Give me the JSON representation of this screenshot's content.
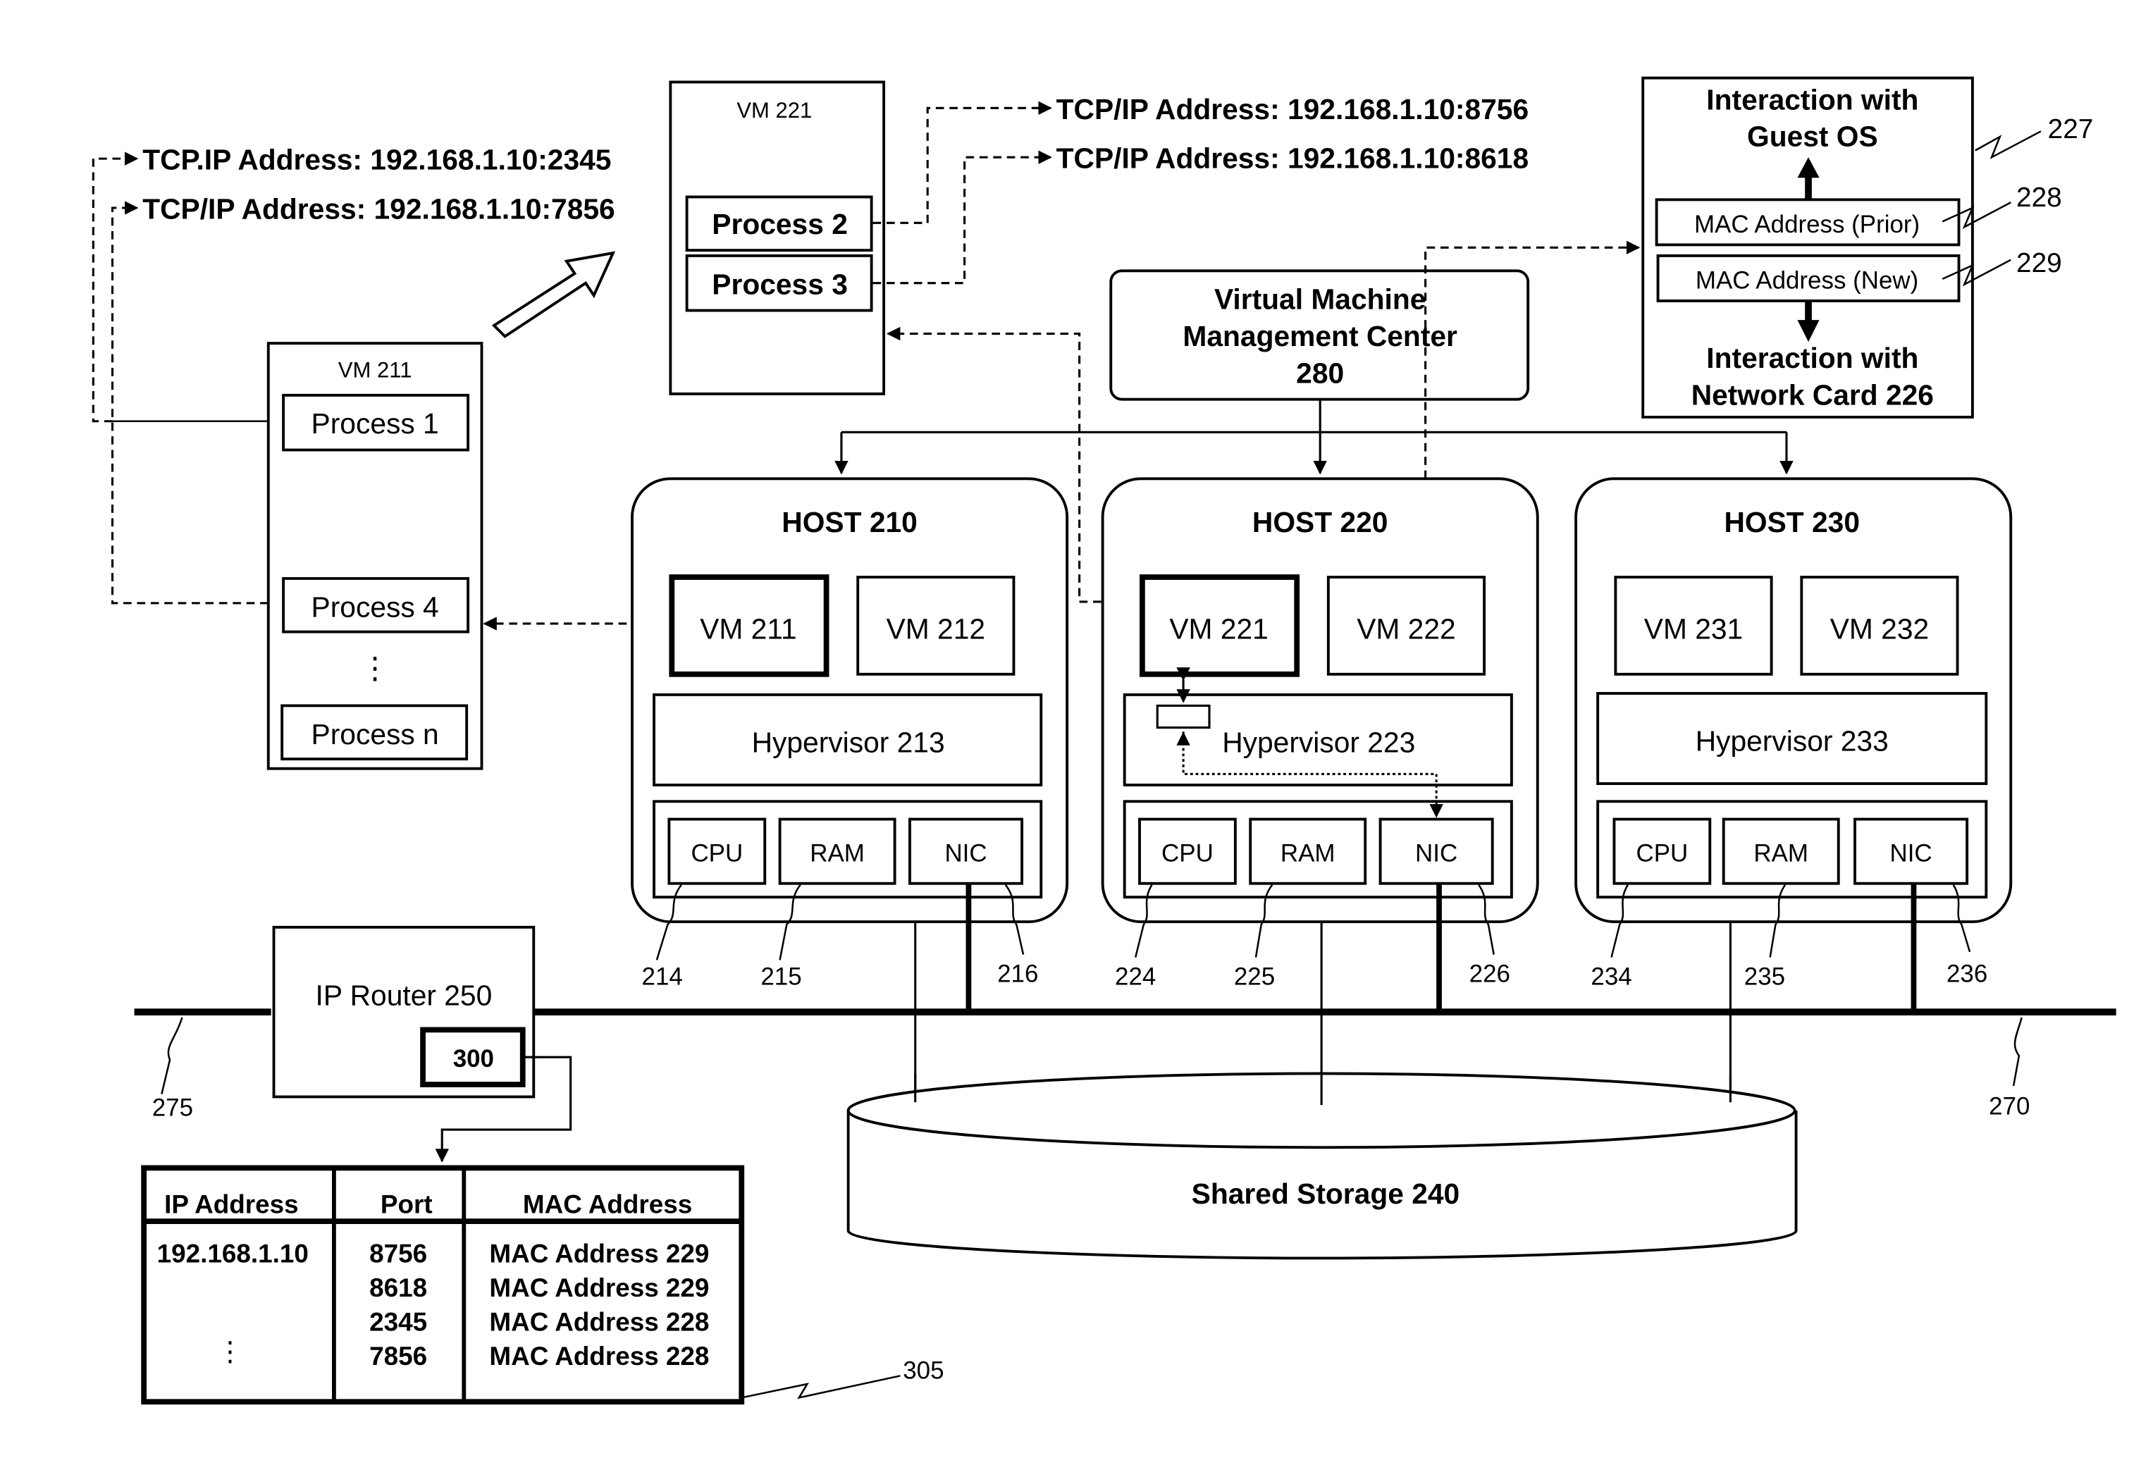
{
  "tcp_labels": {
    "p1": "TCP.IP Address: 192.168.1.10:2345",
    "p4": "TCP/IP Address: 192.168.1.10:7856",
    "p2": "TCP/IP Address: 192.168.1.10:8756",
    "p3": "TCP/IP Address: 192.168.1.10:8618"
  },
  "vm221_detail": {
    "title": "VM 221",
    "processes": [
      "Process 2",
      "Process 3"
    ]
  },
  "vm211_detail": {
    "title": "VM 211",
    "processes": [
      "Process 1",
      "Process 4",
      "Process n"
    ],
    "ellipsis": "⋮"
  },
  "management_center": {
    "line1": "Virtual Machine",
    "line2": "Management Center",
    "line3": "280"
  },
  "mac_panel": {
    "top_line1": "Interaction with",
    "top_line2": "Guest OS",
    "prior": "MAC Address (Prior)",
    "new": "MAC Address (New)",
    "bottom_line1": "Interaction with",
    "bottom_line2": "Network Card 226",
    "ref": "227",
    "prior_ref": "228",
    "new_ref": "229"
  },
  "hosts": [
    {
      "title": "HOST 210",
      "vms": [
        "VM 211",
        "VM 212"
      ],
      "hypervisor": "Hypervisor 213",
      "hardware": [
        "CPU",
        "RAM",
        "NIC"
      ],
      "refs": [
        "214",
        "215",
        "216"
      ]
    },
    {
      "title": "HOST 220",
      "vms": [
        "VM 221",
        "VM 222"
      ],
      "hypervisor": "Hypervisor 223",
      "hardware": [
        "CPU",
        "RAM",
        "NIC"
      ],
      "refs": [
        "224",
        "225",
        "226"
      ]
    },
    {
      "title": "HOST 230",
      "vms": [
        "VM 231",
        "VM 232"
      ],
      "hypervisor": "Hypervisor 233",
      "hardware": [
        "CPU",
        "RAM",
        "NIC"
      ],
      "refs": [
        "234",
        "235",
        "236"
      ]
    }
  ],
  "router": {
    "label": "IP Router 250",
    "module": "300"
  },
  "network_refs": {
    "left": "275",
    "right": "270"
  },
  "storage": {
    "label": "Shared Storage 240"
  },
  "mapping_table": {
    "ref": "305",
    "headers": [
      "IP Address",
      "Port",
      "MAC Address"
    ],
    "ip": "192.168.1.10",
    "ellipsis": "⋮",
    "rows": [
      {
        "port": "8756",
        "mac": "MAC Address 229"
      },
      {
        "port": "8618",
        "mac": "MAC Address 229"
      },
      {
        "port": "2345",
        "mac": "MAC Address 228"
      },
      {
        "port": "7856",
        "mac": "MAC Address 228"
      }
    ]
  }
}
